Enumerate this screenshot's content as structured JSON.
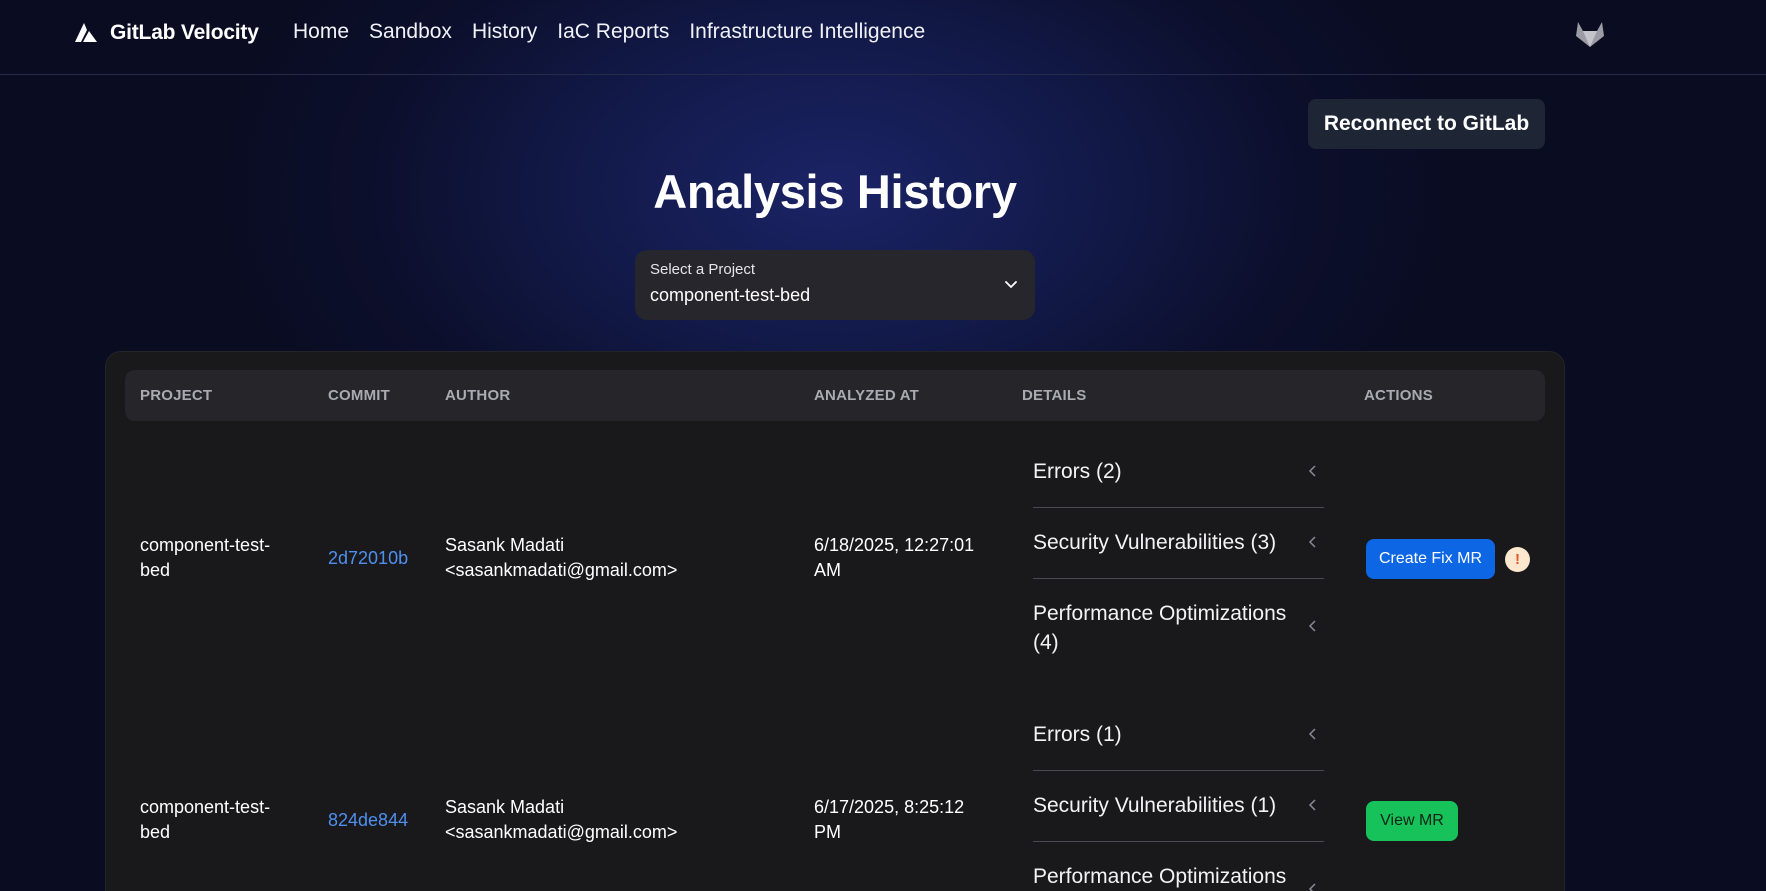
{
  "nav": {
    "brand": "GitLab Velocity",
    "links": [
      "Home",
      "Sandbox",
      "History",
      "IaC Reports",
      "Infrastructure Intelligence"
    ]
  },
  "reconnect_label": "Reconnect to GitLab",
  "page_title": "Analysis History",
  "project_select": {
    "label": "Select a Project",
    "value": "component-test-bed"
  },
  "table": {
    "headers": [
      "PROJECT",
      "COMMIT",
      "AUTHOR",
      "ANALYZED AT",
      "DETAILS",
      "ACTIONS"
    ],
    "rows": [
      {
        "project": [
          "component-test-",
          "bed"
        ],
        "commit": "2d72010b",
        "author": [
          "Sasank Madati",
          "<sasankmadati@gmail.com>"
        ],
        "analyzed_at": [
          "6/18/2025, 12:27:01",
          "AM"
        ],
        "details": [
          [
            "Errors (2)"
          ],
          [
            "Security Vulnerabilities (3)"
          ],
          [
            "Performance Optimizations",
            "(4)"
          ]
        ],
        "action": "Create Fix MR",
        "warning": "!"
      },
      {
        "project": [
          "component-test-",
          "bed"
        ],
        "commit": "824de844",
        "author": [
          "Sasank Madati",
          "<sasankmadati@gmail.com>"
        ],
        "analyzed_at": [
          "6/17/2025, 8:25:12",
          "PM"
        ],
        "details": [
          [
            "Errors (1)"
          ],
          [
            "Security Vulnerabilities (1)"
          ],
          [
            "Performance Optimizations"
          ]
        ],
        "action": "View MR"
      }
    ]
  },
  "colors": {
    "primary_button": "#0d66e4",
    "success_button": "#17c25a",
    "commit_link": "#4f8ff0",
    "warning_icon": "#e2542a"
  },
  "icons": [
    "gitlab-velocity-logo-icon",
    "gitlab-fox-icon",
    "chevron-down-icon",
    "chevron-left-icon",
    "warning-icon"
  ]
}
